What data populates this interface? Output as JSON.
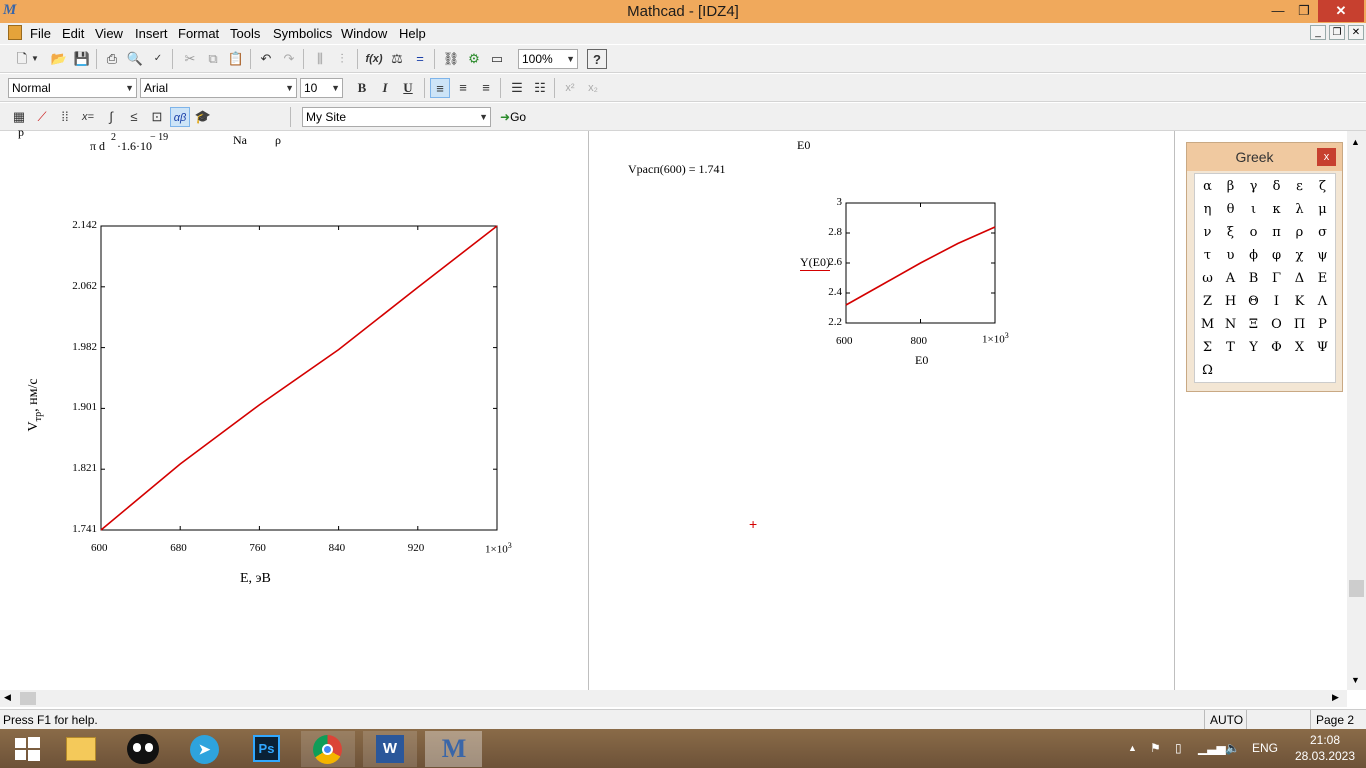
{
  "window": {
    "title": "Mathcad - [IDZ4]",
    "app_icon": "mathcad-logo"
  },
  "window_controls": {
    "minimize": "—",
    "restore": "❐",
    "close": "✕"
  },
  "menu": {
    "items": [
      "File",
      "Edit",
      "View",
      "Insert",
      "Format",
      "Tools",
      "Symbolics",
      "Window",
      "Help"
    ],
    "mdi_minimize": "_",
    "mdi_restore": "❐",
    "mdi_close": "✕"
  },
  "toolbar": {
    "zoom": "100%",
    "style": "Normal",
    "font": "Arial",
    "size": "10",
    "bold": "B",
    "italic": "I",
    "underline": "U",
    "superscript": "x²",
    "subscript": "x₂",
    "site": "My Site",
    "go": "Go"
  },
  "left_region": {
    "formula_top": "p",
    "formula_frac": "π d",
    "formula_exp2": "2",
    "formula_mult": "·1.6·10",
    "formula_exp19": "− 19",
    "formula_na": "Na",
    "formula_rho": "ρ",
    "plot": {
      "ylabel_main": "V",
      "ylabel_sub": "тр",
      "ylabel_tail": ", нм/с",
      "xlabel": "E, эВ",
      "yticks": [
        "2.142",
        "2.062",
        "1.982",
        "1.901",
        "1.821",
        "1.741"
      ],
      "xticks": [
        "600",
        "680",
        "760",
        "840",
        "920"
      ],
      "xtick_last": "1×10",
      "xtick_last_exp": "3"
    }
  },
  "right_region": {
    "e0_top": "E0",
    "result_lhs": "Vрасп(600)",
    "result_eq": "=",
    "result_val": "1.741",
    "plot": {
      "ylabel": "Y(E0)",
      "xlabel": "E0",
      "yticks": [
        "3",
        "2.8",
        "2.6",
        "2.4",
        "2.2"
      ],
      "xticks": [
        "600",
        "800"
      ],
      "xtick_last": "1×10",
      "xtick_last_exp": "3"
    }
  },
  "chart_data": [
    {
      "type": "line",
      "xlabel": "E, эВ",
      "ylabel": "Vтр, нм/с",
      "xlim": [
        600,
        1000
      ],
      "ylim": [
        1.741,
        2.142
      ],
      "grid": false,
      "color": "#d40000",
      "x": [
        600,
        680,
        760,
        840,
        920,
        1000
      ],
      "values": [
        1.741,
        1.828,
        1.906,
        1.979,
        2.061,
        2.142
      ]
    },
    {
      "type": "line",
      "xlabel": "E0",
      "ylabel": "Y(E0)",
      "xlim": [
        600,
        1000
      ],
      "ylim": [
        2.2,
        3.0
      ],
      "grid": false,
      "color": "#d40000",
      "x": [
        600,
        700,
        800,
        900,
        1000
      ],
      "values": [
        2.32,
        2.46,
        2.6,
        2.73,
        2.84
      ]
    }
  ],
  "greek": {
    "title": "Greek",
    "close": "x",
    "letters": [
      "α",
      "β",
      "γ",
      "δ",
      "ε",
      "ζ",
      "η",
      "θ",
      "ι",
      "κ",
      "λ",
      "μ",
      "ν",
      "ξ",
      "ο",
      "π",
      "ρ",
      "σ",
      "τ",
      "υ",
      "ϕ",
      "φ",
      "χ",
      "ψ",
      "ω",
      "Α",
      "Β",
      "Γ",
      "Δ",
      "Ε",
      "Ζ",
      "Η",
      "Θ",
      "Ι",
      "Κ",
      "Λ",
      "Μ",
      "Ν",
      "Ξ",
      "Ο",
      "Π",
      "Ρ",
      "Σ",
      "Τ",
      "Υ",
      "Φ",
      "Χ",
      "Ψ",
      "Ω"
    ]
  },
  "status": {
    "help": "Press F1 for help.",
    "mode": "AUTO",
    "page": "Page 2"
  },
  "taskbar": {
    "ps": "Ps",
    "word": "W",
    "mathcad": "M",
    "lang": "ENG",
    "time": "21:08",
    "date": "28.03.2023"
  },
  "colors": {
    "title_bar": "#f0a95c",
    "plot_line": "#d40000",
    "greek_bg": "#f3e6d4"
  }
}
